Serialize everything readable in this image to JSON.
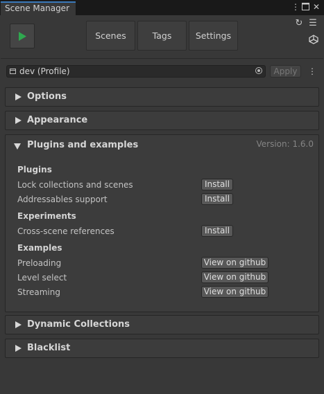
{
  "window": {
    "tab_title": "Scene Manager",
    "menu_icon": "more-vert-icon",
    "maximize_icon": "maximize-icon",
    "close_icon": "close-icon"
  },
  "toolbar": {
    "play_icon": "play-icon",
    "tabs": [
      "Scenes",
      "Tags",
      "Settings"
    ],
    "refresh_icon": "refresh-icon",
    "menu_icon": "hamburger-menu-icon",
    "unity_icon": "unity-logo-icon"
  },
  "profile": {
    "value": "dev (Profile)",
    "apply_label": "Apply",
    "picker_icon": "object-picker-icon",
    "more_icon": "kebab-menu-icon"
  },
  "sections": {
    "options": "Options",
    "appearance": "Appearance",
    "plugins": "Plugins and examples",
    "dynamic": "Dynamic Collections",
    "blacklist": "Blacklist"
  },
  "plugins_panel": {
    "version": "Version: 1.6.0",
    "plugins_header": "Plugins",
    "plugins": [
      {
        "label": "Lock collections and scenes",
        "button": "Install"
      },
      {
        "label": "Addressables support",
        "button": "Install"
      }
    ],
    "experiments_header": "Experiments",
    "experiments": [
      {
        "label": "Cross-scene references",
        "button": "Install"
      }
    ],
    "examples_header": "Examples",
    "examples": [
      {
        "label": "Preloading",
        "button": "View on github"
      },
      {
        "label": "Level select",
        "button": "View on github"
      },
      {
        "label": "Streaming",
        "button": "View on github"
      }
    ]
  },
  "colors": {
    "background": "#383838",
    "accent": "#3a79bb",
    "play_green": "#2fa84f"
  }
}
